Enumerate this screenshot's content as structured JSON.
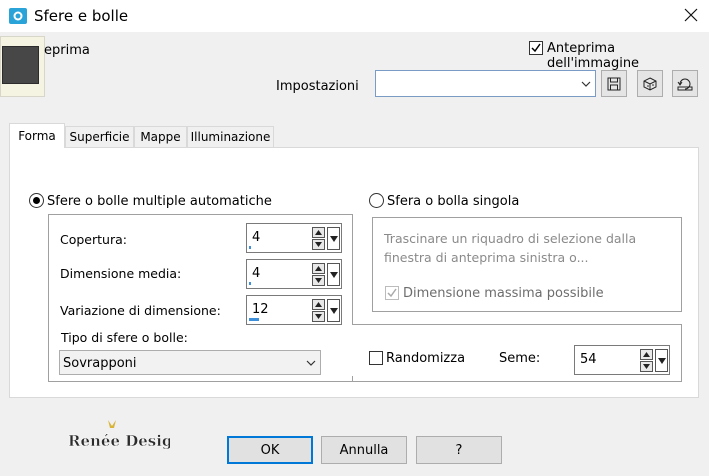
{
  "window": {
    "title": "Sfere e bolle"
  },
  "header": {
    "preview_label": "eprima",
    "image_preview_label": "Anteprima dell'immagine",
    "image_preview_checked": true,
    "settings_label": "Impostazioni",
    "settings_value": ""
  },
  "tabs": [
    {
      "label": "Forma",
      "active": true
    },
    {
      "label": "Superficie"
    },
    {
      "label": "Mappe"
    },
    {
      "label": "Illuminazione"
    }
  ],
  "auto": {
    "label": "Sfere o bolle multiple automatiche",
    "selected": true,
    "coverage_label": "Copertura:",
    "coverage_value": "4",
    "mean_size_label": "Dimensione media:",
    "mean_size_value": "4",
    "size_variation_label": "Variazione di dimensione:",
    "size_variation_value": "12",
    "type_label": "Tipo di sfere o bolle:",
    "type_value": "Sovrapponi"
  },
  "single": {
    "label": "Sfera o bolla singola",
    "selected": false,
    "description": "Trascinare un riquadro di selezione dalla finestra di anteprima sinistra o...",
    "max_size_label": "Dimensione massima possibile",
    "max_size_checked": true
  },
  "random": {
    "label": "Randomizza",
    "checked": false,
    "seed_label": "Seme:",
    "seed_value": "54"
  },
  "buttons": {
    "ok": "OK",
    "cancel": "Annulla",
    "help": "?"
  },
  "logo_text": "Renée Design",
  "colors": {
    "accent": "#0078d7",
    "app_icon": "#2aa3d8"
  },
  "icons": [
    "app-icon",
    "close-icon",
    "dropdown-arrow-icon",
    "save-icon",
    "cube-icon",
    "reset-icon",
    "spin-up-icon",
    "spin-down-icon",
    "check-icon"
  ]
}
